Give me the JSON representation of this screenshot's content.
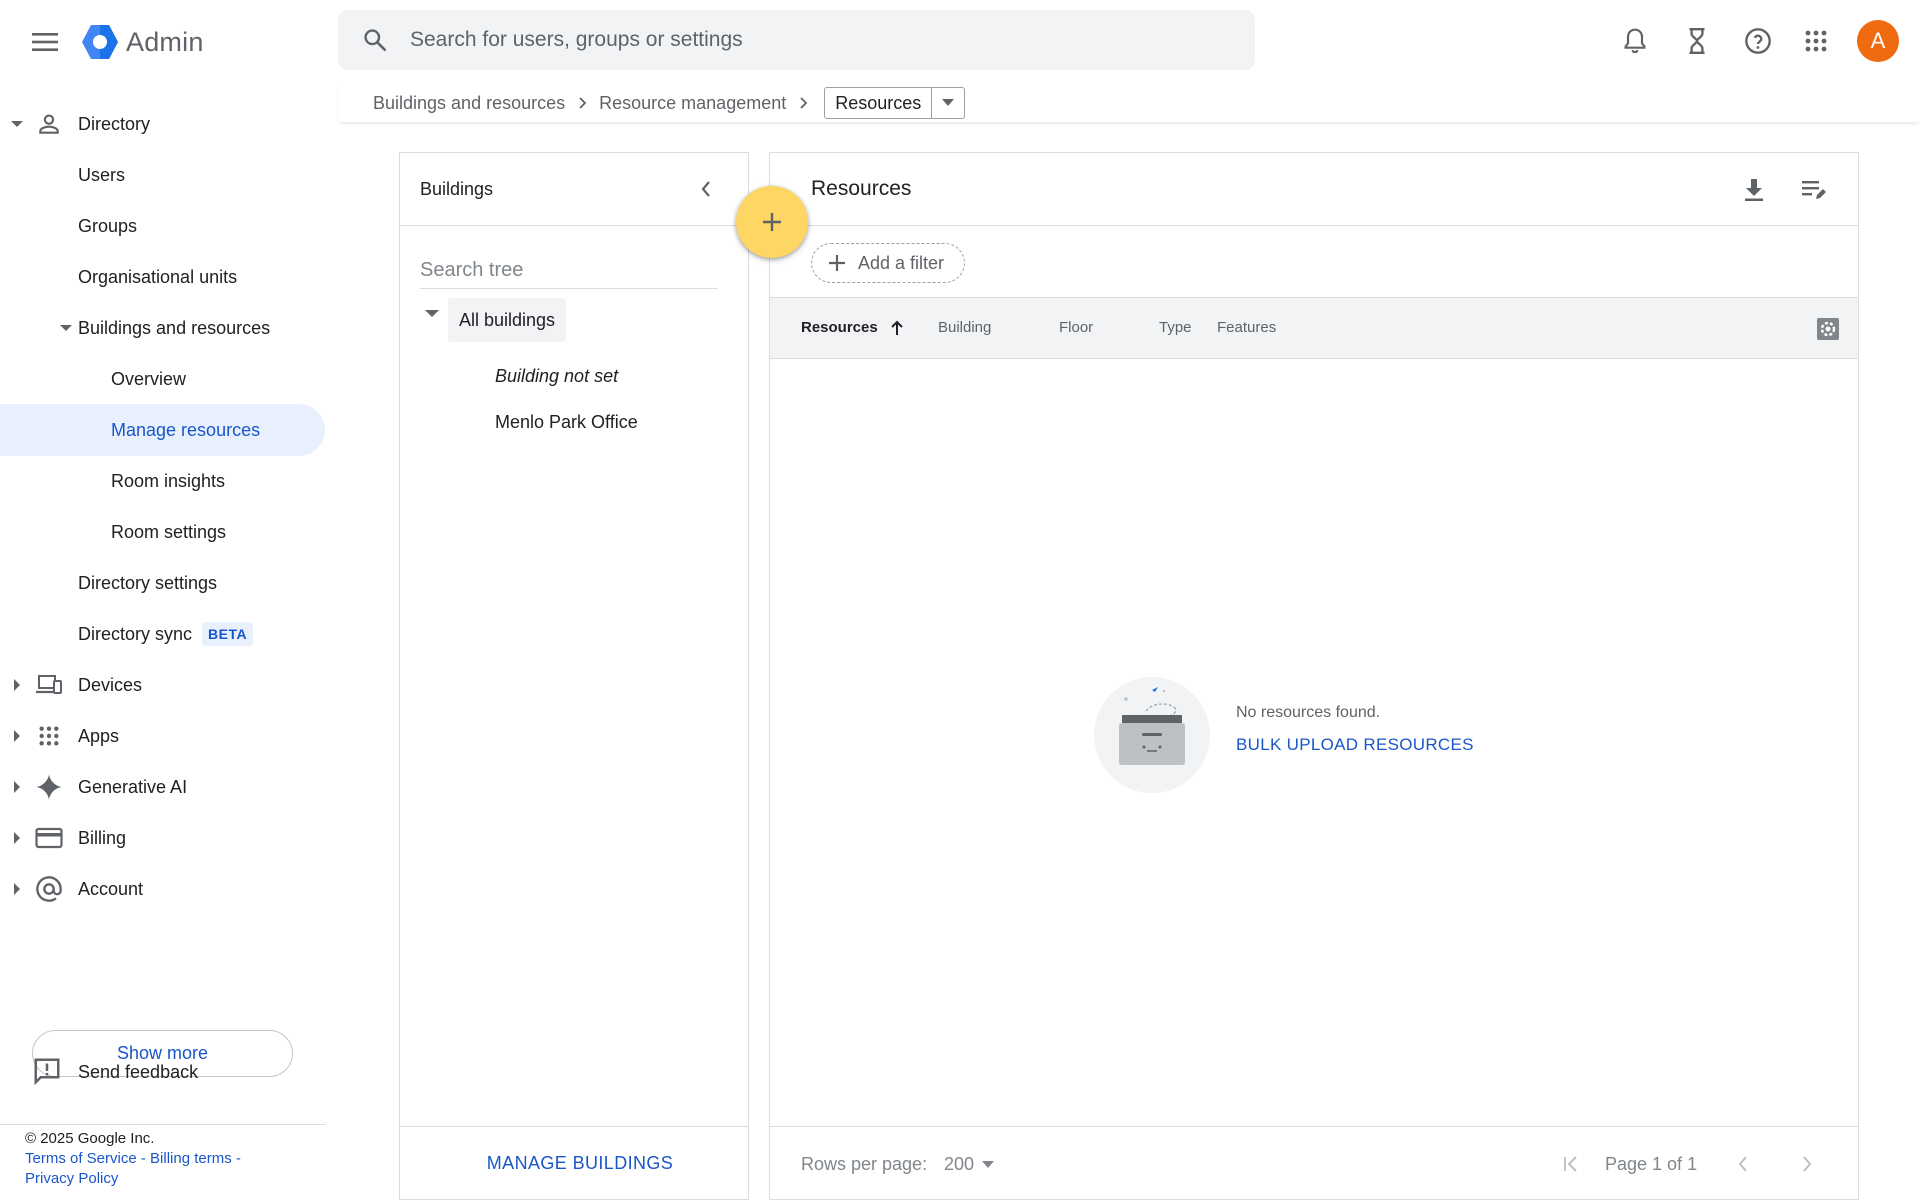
{
  "app": {
    "name": "Admin",
    "brand_color": "#1a73e8",
    "accent_color": "#1a56c9"
  },
  "search": {
    "placeholder": "Search for users, groups or settings",
    "value": ""
  },
  "topbar": {
    "icons": [
      "menu-icon",
      "notifications-icon",
      "hourglass-icon",
      "help-icon",
      "apps-grid-icon"
    ],
    "avatar_letter": "A",
    "avatar_color": "#f06a0f"
  },
  "breadcrumb": {
    "items": [
      "Buildings and resources",
      "Resource management"
    ],
    "current": "Resources"
  },
  "sidebar": {
    "directory": "Directory",
    "users": "Users",
    "groups": "Groups",
    "org_units": "Organisational units",
    "buildings_resources": "Buildings and resources",
    "overview": "Overview",
    "manage_resources": "Manage resources",
    "room_insights": "Room insights",
    "room_settings": "Room settings",
    "directory_settings": "Directory settings",
    "directory_sync": "Directory sync",
    "beta_badge": "BETA",
    "devices": "Devices",
    "apps": "Apps",
    "generative_ai": "Generative AI",
    "billing": "Billing",
    "account": "Account",
    "show_more": "Show more",
    "send_feedback": "Send feedback"
  },
  "footer": {
    "copyright": "© 2025 Google Inc.",
    "terms": "Terms of Service",
    "billing_terms": "Billing terms",
    "privacy": "Privacy Policy",
    "separator": " - "
  },
  "buildings_panel": {
    "title": "Buildings",
    "search_placeholder": "Search tree",
    "tree": {
      "root": "All buildings",
      "children": [
        "Building not set",
        "Menlo Park Office"
      ]
    },
    "manage_button": "MANAGE BUILDINGS"
  },
  "resources_panel": {
    "title": "Resources",
    "add_filter": "Add a filter",
    "columns": [
      "Resources",
      "Building",
      "Floor",
      "Type",
      "Features"
    ],
    "sorted_column": "Resources",
    "sort_direction": "ascending",
    "empty_message": "No resources found.",
    "bulk_upload": "BULK UPLOAD RESOURCES",
    "rows_per_page_label": "Rows per page:",
    "rows_per_page_value": "200",
    "page_info": "Page 1 of 1"
  }
}
